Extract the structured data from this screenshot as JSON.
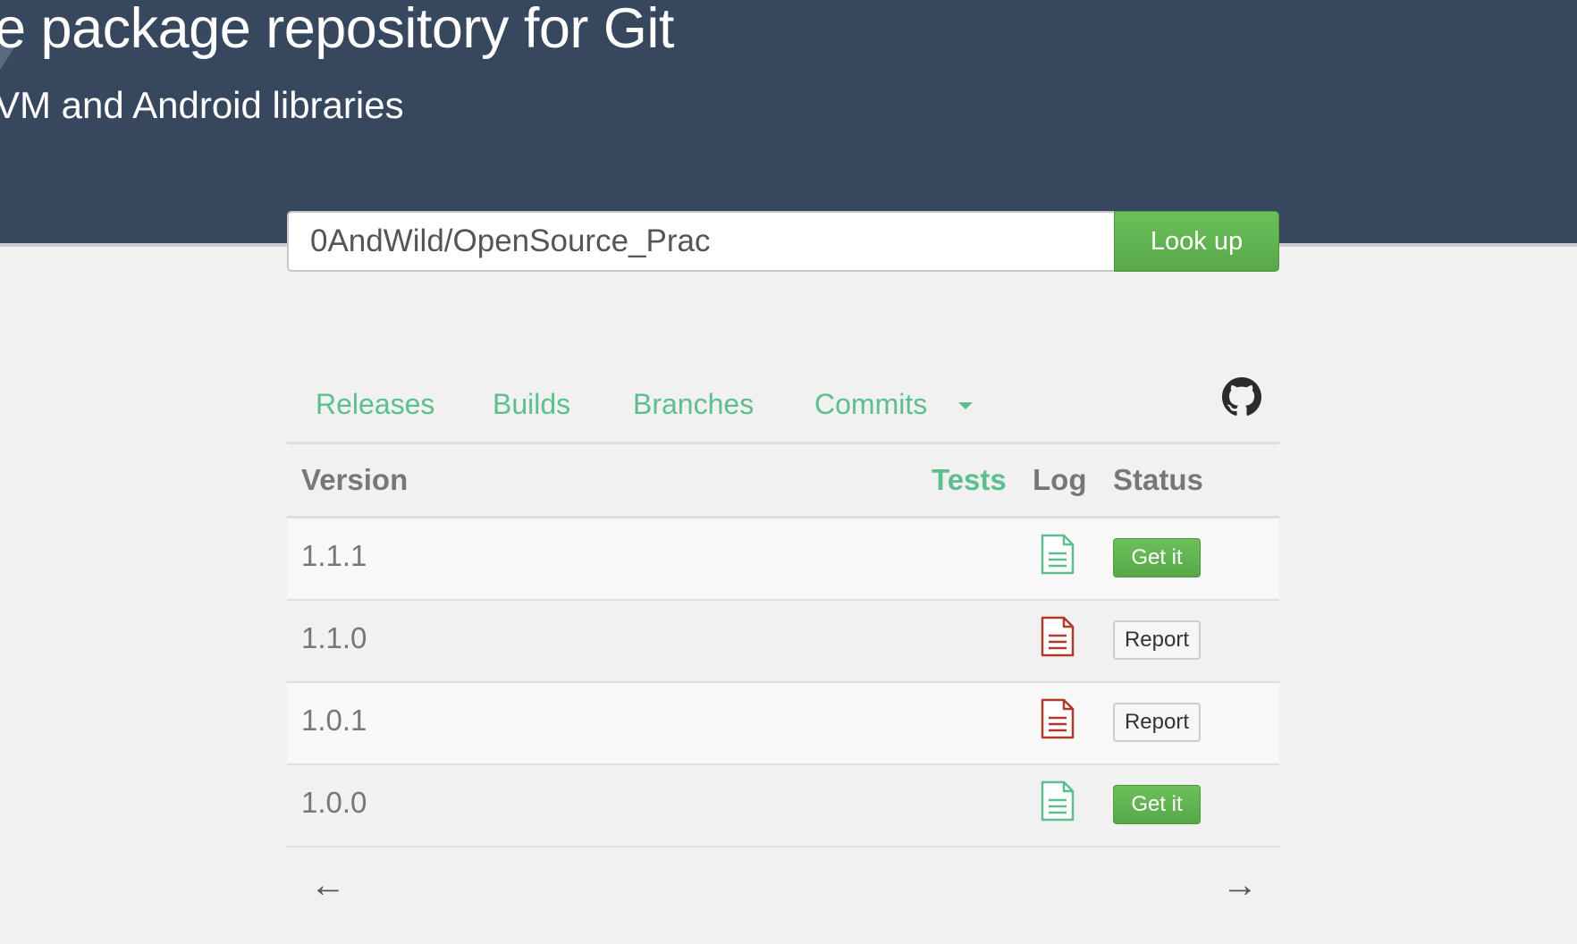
{
  "hero": {
    "title": "e package repository for Git",
    "subtitle": "VM and Android libraries"
  },
  "search": {
    "value": "0AndWild/OpenSource_Prac",
    "button_label": "Look up"
  },
  "tabs": [
    {
      "label": "Releases"
    },
    {
      "label": "Builds"
    },
    {
      "label": "Branches"
    },
    {
      "label": "Commits"
    }
  ],
  "table": {
    "headers": {
      "version": "Version",
      "tests": "Tests",
      "log": "Log",
      "status": "Status"
    },
    "rows": [
      {
        "version": "1.1.1",
        "log_status": "success",
        "status_label": "Get it"
      },
      {
        "version": "1.1.0",
        "log_status": "error",
        "status_label": "Report"
      },
      {
        "version": "1.0.1",
        "log_status": "error",
        "status_label": "Report"
      },
      {
        "version": "1.0.0",
        "log_status": "success",
        "status_label": "Get it"
      }
    ]
  },
  "pager": {
    "prev": "←",
    "next": "→"
  },
  "icons": {
    "github": "github-icon",
    "log_success": "document-icon",
    "log_error": "document-icon"
  },
  "colors": {
    "header_bg": "#37475d",
    "accent_green": "#5cbf8d",
    "button_green": "#5cb04c",
    "error_red": "#b0392d"
  }
}
